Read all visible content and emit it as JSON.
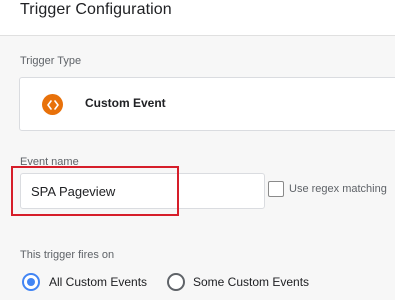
{
  "header": {
    "title": "Trigger Configuration"
  },
  "trigger_type": {
    "label": "Trigger Type",
    "selected_type": "Custom Event",
    "icon": "custom-event-icon",
    "icon_color": "#e8710a"
  },
  "event_name": {
    "label": "Event name",
    "value": "SPA Pageview",
    "highlight_color": "#d61e2a"
  },
  "regex": {
    "label": "Use regex matching",
    "checked": false
  },
  "fires_on": {
    "label": "This trigger fires on",
    "options": [
      {
        "label": "All Custom Events",
        "selected": true
      },
      {
        "label": "Some Custom Events",
        "selected": false
      }
    ],
    "accent_color": "#4285f4"
  }
}
